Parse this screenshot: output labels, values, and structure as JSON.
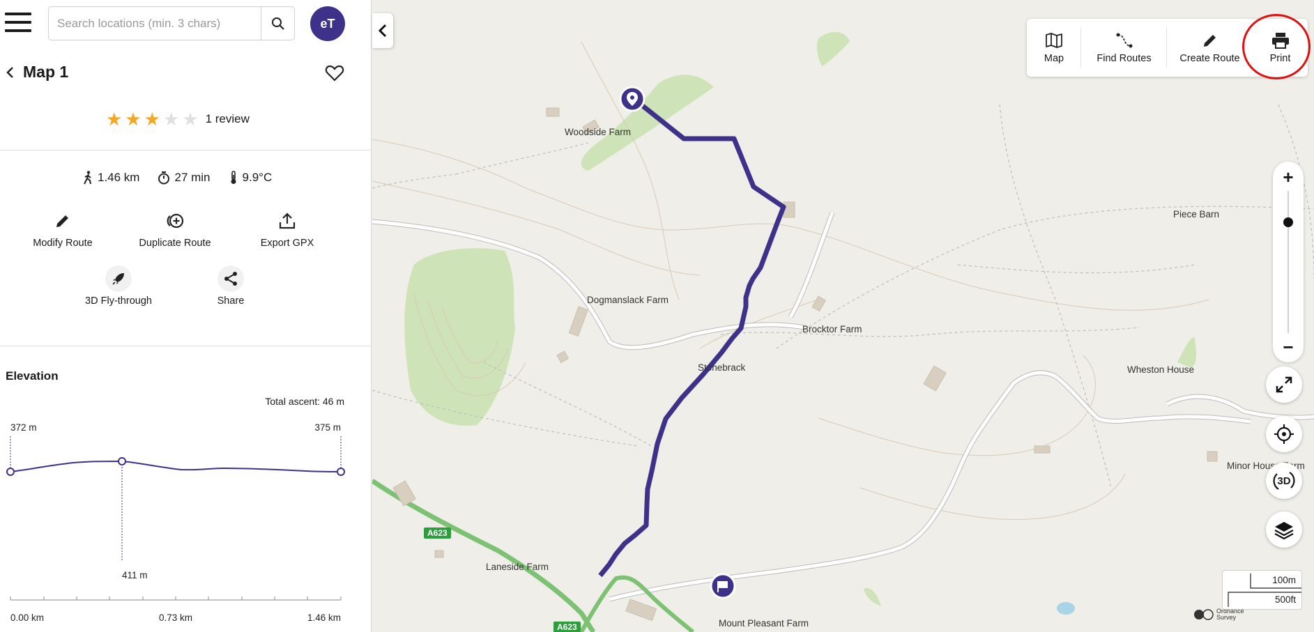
{
  "search": {
    "placeholder": "Search locations (min. 3 chars)"
  },
  "user": {
    "initials": "eT"
  },
  "route": {
    "title": "Map 1",
    "rating": 3,
    "max_rating": 5,
    "review_text": "1 review",
    "distance": "1.46 km",
    "duration": "27 min",
    "temperature": "9.9°C"
  },
  "actions": {
    "modify": "Modify Route",
    "duplicate": "Duplicate Route",
    "export": "Export GPX",
    "flythrough": "3D Fly-through",
    "share": "Share"
  },
  "elevation": {
    "title": "Elevation",
    "total_ascent": "Total ascent: 46 m",
    "start_label": "372 m",
    "end_label": "375 m",
    "peak_label": "411 m",
    "x_labels": [
      "0.00 km",
      "0.73 km",
      "1.46 km"
    ]
  },
  "toolbar": {
    "map": "Map",
    "find_routes": "Find Routes",
    "create_route": "Create Route",
    "print": "Print"
  },
  "zoom_level": 0.22,
  "badge_3d": "3D",
  "scale": {
    "metric": "100m",
    "imperial": "500ft"
  },
  "map_labels": {
    "woodside": "Woodside Farm",
    "piece_barn": "Piece Barn",
    "dogmanslack": "Dogmanslack Farm",
    "brocktor": "Brocktor Farm",
    "stonebrack": "Stonebrack",
    "wheston": "Wheston House",
    "minor_house": "Minor House Farm",
    "laneside": "Laneside Farm",
    "mount_pleasant": "Mount Pleasant Farm",
    "road_a623": "A623",
    "os_text": "Ordnance Survey"
  }
}
